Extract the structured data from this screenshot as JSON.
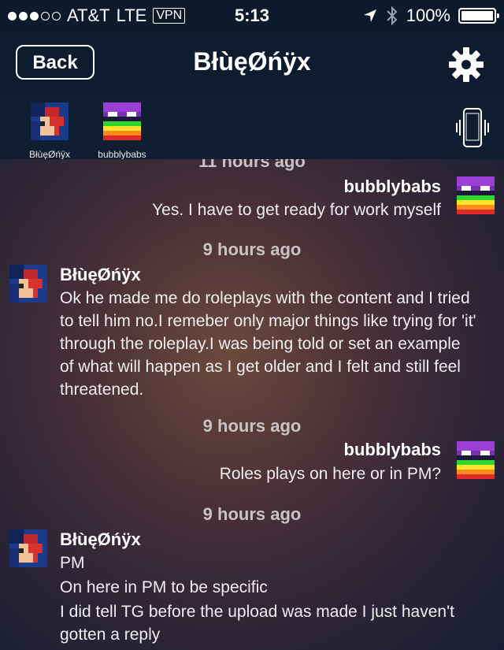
{
  "status": {
    "carrier": "AT&T",
    "network": "LTE",
    "vpn": "VPN",
    "time": "5:13",
    "battery": "100%"
  },
  "nav": {
    "back_label": "Back",
    "title": "BłùęØńÿx",
    "settings_icon": "gear-icon"
  },
  "users": [
    {
      "name": "BłùęØńÿx"
    },
    {
      "name": "bubblybabs"
    }
  ],
  "messages": {
    "ts0": "11 hours ago",
    "m1": {
      "sender": "bubblybabs",
      "text": "Yes.  I have to get ready for work myself"
    },
    "ts1": "9 hours ago",
    "m2": {
      "sender": "BłùęØńÿx",
      "text": "Ok he made me do roleplays with the content and I tried to tell him no.I remeber only major things like trying for 'it' through the roleplay.I was being told or set an example of what will happen as I get older and I felt and still feel threatened."
    },
    "ts2": "9 hours ago",
    "m3": {
      "sender": "bubblybabs",
      "text": "Roles plays on here or in PM?"
    },
    "ts3": "9 hours ago",
    "m4": {
      "sender": "BłùęØńÿx",
      "lines": [
        "PM",
        "On here in PM to be specific",
        "I did tell TG before the upload was made I just haven't gotten a reply"
      ]
    }
  }
}
